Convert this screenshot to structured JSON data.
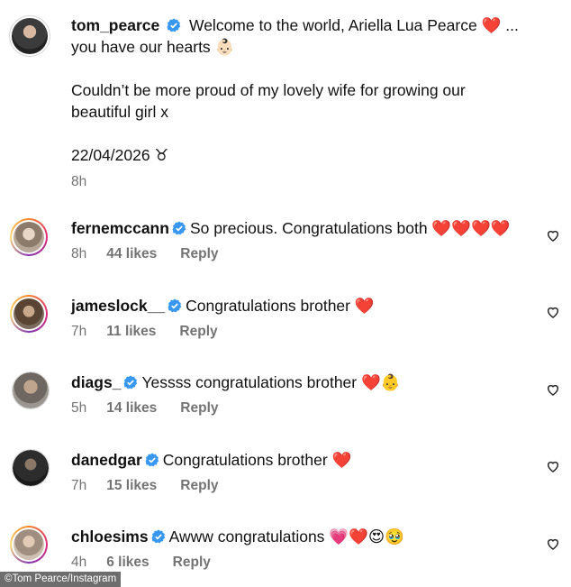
{
  "caption": {
    "username": "tom_pearce",
    "line1": "Welcome to the world, Ariella Lua Pearce ❤️ ...",
    "line2": "you have our hearts 👶🏻",
    "line3": "Couldn’t be more proud of my lovely wife for growing our",
    "line4": "beautiful girl x",
    "date": "22/04/2026 ♉",
    "time": "8h"
  },
  "comments": [
    {
      "username": "fernemccann",
      "text": "So precious. Congratulations both ❤️❤️❤️❤️",
      "time": "8h",
      "likes": "44 likes",
      "reply": "Reply"
    },
    {
      "username": "jameslock__",
      "text": "Congratulations brother ❤️",
      "time": "7h",
      "likes": "11 likes",
      "reply": "Reply"
    },
    {
      "username": "diags_",
      "text": "Yessss congratulations brother ❤️👶",
      "time": "5h",
      "likes": "14 likes",
      "reply": "Reply"
    },
    {
      "username": "danedgar",
      "text": "Congratulations brother ❤️",
      "time": "7h",
      "likes": "15 likes",
      "reply": "Reply"
    },
    {
      "username": "chloesims",
      "text": "Awww congratulations 💗❤️😍🥹",
      "time": "4h",
      "likes": "6 likes",
      "reply": "Reply"
    }
  ],
  "watermark": "©Tom Pearce/Instagram",
  "colors": {
    "verified": "#3897f0",
    "muted": "#737373"
  }
}
